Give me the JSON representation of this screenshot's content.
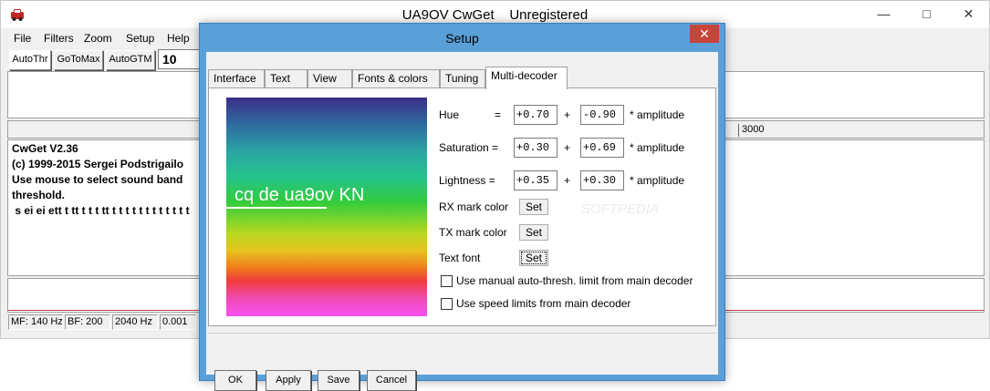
{
  "main": {
    "title": "UA9OV CwGet    Unregistered",
    "controls": {
      "minimize": "—",
      "maximize": "□",
      "close": "✕"
    },
    "menu": [
      "File",
      "Filters",
      "Zoom",
      "Setup",
      "Help"
    ],
    "toolbar": {
      "autothr": "AutoThr",
      "gotomax": "GoToMax",
      "autogtm": "AutoGTM",
      "speed_value": "10"
    },
    "scale_label": "3000",
    "text_lines": [
      "CwGet  V2.36",
      "(c) 1999-2015 Sergei Podstrigailo",
      "Use mouse to select sound band",
      "threshold.",
      " s ei ei ett t tt t t t tt t t t t t t t t t t t t"
    ],
    "status": [
      "MF: 140 Hz",
      "BF: 200",
      "2040 Hz",
      "0.001"
    ]
  },
  "dialog": {
    "title": "Setup",
    "close": "✕",
    "tabs": [
      "Interface",
      "Text",
      "View",
      "Fonts & colors",
      "Tuning",
      "Multi-decoder"
    ],
    "active_tab": "Multi-decoder",
    "preview_text": "cq de ua9ov KN",
    "hue": {
      "label": "Hue",
      "eq": "=",
      "base": "+0.70",
      "plus": "+",
      "factor": "-0.90",
      "suffix": "* amplitude"
    },
    "saturation": {
      "label": "Saturation =",
      "base": "+0.30",
      "plus": "+",
      "factor": "+0.69",
      "suffix": "* amplitude"
    },
    "lightness": {
      "label": "Lightness =",
      "base": "+0.35",
      "plus": "+",
      "factor": "+0.30",
      "suffix": "* amplitude"
    },
    "rx_mark": {
      "label": "RX mark color",
      "button": "Set"
    },
    "tx_mark": {
      "label": "TX mark color",
      "button": "Set"
    },
    "text_font": {
      "label": "Text font",
      "button": "Set"
    },
    "chk_manual": "Use manual auto-thresh. limit from main decoder",
    "chk_speed": "Use speed limits from main decoder",
    "buttons": {
      "ok": "OK",
      "apply": "Apply",
      "save": "Save",
      "cancel": "Cancel"
    },
    "watermark": "SOFTPEDIA"
  },
  "colors": {
    "dialog_frame": "#5aa0d8",
    "close_button": "#c7443a",
    "window_bg": "#f0f0f0"
  }
}
